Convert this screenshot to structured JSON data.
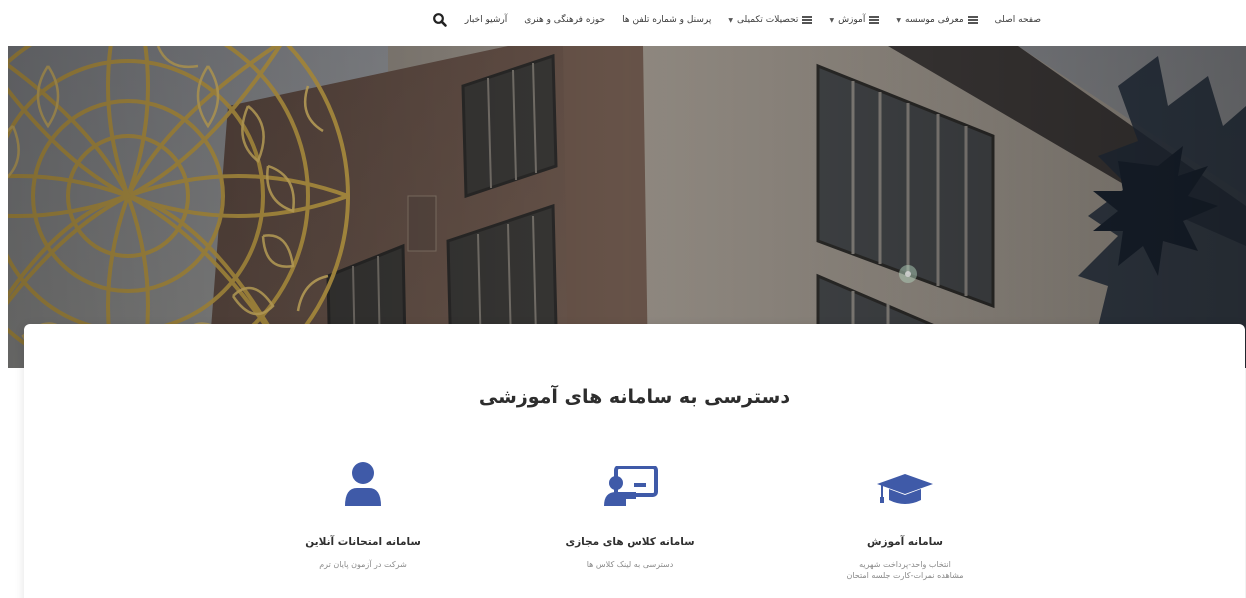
{
  "nav": {
    "items": [
      {
        "label": "صفحه اصلی",
        "menu_icon": false,
        "caret": false
      },
      {
        "label": "معرفی موسسه",
        "menu_icon": true,
        "caret": true
      },
      {
        "label": "آموزش",
        "menu_icon": true,
        "caret": true
      },
      {
        "label": "تحصیلات تکمیلی",
        "menu_icon": true,
        "caret": true
      },
      {
        "label": "پرسنل و شماره تلفن ها",
        "menu_icon": false,
        "caret": false
      },
      {
        "label": "حوزه فرهنگی و هنری",
        "menu_icon": false,
        "caret": false
      },
      {
        "label": "آرشیو اخبار",
        "menu_icon": false,
        "caret": false
      }
    ],
    "search_icon": "search-icon"
  },
  "section": {
    "title": "دسترسی به سامانه های آموزشی"
  },
  "services": [
    {
      "name": "سامانه آموزش",
      "icon": "graduation-cap-icon",
      "desc_line1": "انتخاب واحد-پرداخت شهریه",
      "desc_line2": "مشاهده نمرات-کارت جلسه امتحان"
    },
    {
      "name": "سامانه کلاس های مجازی",
      "icon": "virtual-class-icon",
      "desc_line1": "دسترسی به لینک کلاس ها",
      "desc_line2": ""
    },
    {
      "name": "سامانه امتحانات آنلاین",
      "icon": "user-icon",
      "desc_line1": "شرکت در آزمون پایان ترم",
      "desc_line2": ""
    }
  ],
  "colors": {
    "accent": "#3f5aa8",
    "title_text": "#2d2d2d",
    "muted_text": "#8a8a8a"
  }
}
